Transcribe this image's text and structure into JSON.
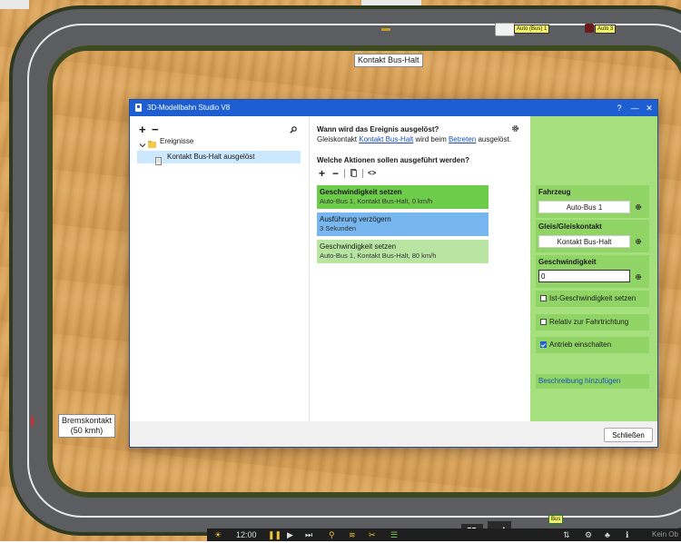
{
  "scene": {
    "top_tags": [
      "Auto (Bus) 1",
      "Auto 3"
    ],
    "label_bus_halt": "Kontakt Bus-Halt",
    "label_brake_line1": "Bremskontakt",
    "label_brake_line2": "(50 kmh)",
    "bottom_tag": "Bus"
  },
  "window": {
    "title": "3D-Modellbahn Studio V8",
    "help": "?",
    "minimize": "—",
    "close": "✕"
  },
  "tree": {
    "add": "+",
    "remove": "−",
    "folder_label": "Ereignisse",
    "item_label": "Kontakt Bus-Halt ausgelöst"
  },
  "event": {
    "question": "Wann wird das Ereignis ausgelöst?",
    "desc_prefix": "Gleiskontakt ",
    "desc_link1": "Kontakt Bus-Halt",
    "desc_mid": " wird beim ",
    "desc_link2": "Betreten",
    "desc_suffix": " ausgelöst.",
    "actions_question": "Welche Aktionen sollen ausgeführt werden?",
    "code_label": "<>"
  },
  "actions": [
    {
      "title": "Geschwindigkeit setzen",
      "sub": "Auto-Bus 1, Kontakt Bus-Halt, 0 km/h",
      "color": "#6dcc4a"
    },
    {
      "title": "Ausführung verzögern",
      "sub": "3 Sekunden",
      "color": "#77b6ef"
    },
    {
      "title": "Geschwindigkeit setzen",
      "sub": "Auto-Bus 1, Kontakt Bus-Halt, 80 km/h",
      "color": "#b9e5a3"
    }
  ],
  "props": {
    "vehicle_label": "Fahrzeug",
    "vehicle_value": "Auto-Bus 1",
    "track_label": "Gleis/Gleiskontakt",
    "track_value": "Kontakt Bus-Halt",
    "speed_label": "Geschwindigkeit",
    "speed_value": "0",
    "check_actual": {
      "label": "Ist-Geschwindigkeit setzen",
      "checked": false
    },
    "check_relative": {
      "label": "Relativ zur Fahrtrichtung",
      "checked": false
    },
    "check_drive": {
      "label": "Antrieb einschalten",
      "checked": true
    },
    "add_description": "Beschreibung hinzufügen"
  },
  "footer": {
    "close_button": "Schließen"
  },
  "taskbar": {
    "time": "12:00",
    "status_text": "Kein Ob"
  }
}
